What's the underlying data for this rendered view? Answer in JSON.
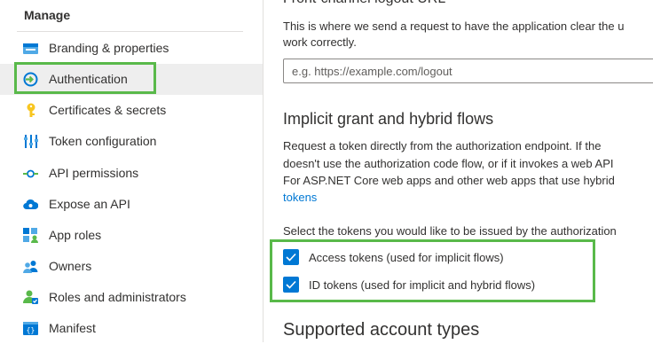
{
  "sidebar": {
    "title": "Manage",
    "items": [
      {
        "label": "Branding & properties",
        "icon": "branding-icon"
      },
      {
        "label": "Authentication",
        "icon": "authentication-icon",
        "active": true
      },
      {
        "label": "Certificates & secrets",
        "icon": "key-icon"
      },
      {
        "label": "Token configuration",
        "icon": "token-config-icon"
      },
      {
        "label": "API permissions",
        "icon": "api-permissions-icon"
      },
      {
        "label": "Expose an API",
        "icon": "cloud-icon"
      },
      {
        "label": "App roles",
        "icon": "app-roles-icon"
      },
      {
        "label": "Owners",
        "icon": "owners-icon"
      },
      {
        "label": "Roles and administrators",
        "icon": "roles-admin-icon"
      },
      {
        "label": "Manifest",
        "icon": "manifest-icon"
      }
    ]
  },
  "main": {
    "front_channel": {
      "heading": "Front-channel logout URL",
      "desc_line1": "This is where we send a request to have the application clear the u",
      "desc_line2": "work correctly.",
      "input_value": "",
      "input_placeholder": "e.g. https://example.com/logout"
    },
    "implicit": {
      "heading": "Implicit grant and hybrid flows",
      "desc_line1": "Request a token directly from the authorization endpoint. If the",
      "desc_line2": "doesn't use the authorization code flow, or if it invokes a web API",
      "desc_line3": "For ASP.NET Core web apps and other web apps that use hybrid",
      "desc_link": "tokens",
      "select_prompt": "Select the tokens you would like to be issued by the authorization",
      "checkboxes": [
        {
          "label": "Access tokens (used for implicit flows)",
          "checked": true
        },
        {
          "label": "ID tokens (used for implicit and hybrid flows)",
          "checked": true
        }
      ]
    },
    "supported": {
      "heading": "Supported account types"
    }
  },
  "colors": {
    "accent": "#0078d4",
    "highlight": "#59b94a",
    "active_bg": "#eeeeee"
  }
}
